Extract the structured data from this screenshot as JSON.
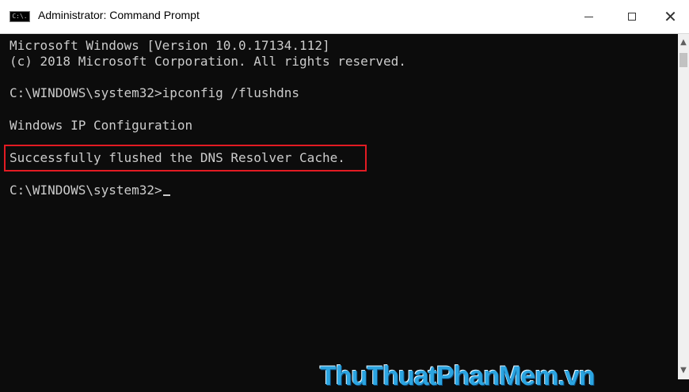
{
  "window": {
    "title": "Administrator: Command Prompt",
    "icon": "cmd-icon",
    "app_icon_text": "C:\\."
  },
  "console": {
    "lines": [
      "Microsoft Windows [Version 10.0.17134.112]",
      "(c) 2018 Microsoft Corporation. All rights reserved.",
      "",
      "C:\\WINDOWS\\system32>ipconfig /flushdns",
      "",
      "Windows IP Configuration",
      "",
      "Successfully flushed the DNS Resolver Cache.",
      "",
      "C:\\WINDOWS\\system32>"
    ],
    "highlight_color": "#e31b23",
    "text_color": "#cccccc",
    "background": "#0c0c0c"
  },
  "watermark": {
    "text": "ThuThuatPhanMem.vn"
  }
}
